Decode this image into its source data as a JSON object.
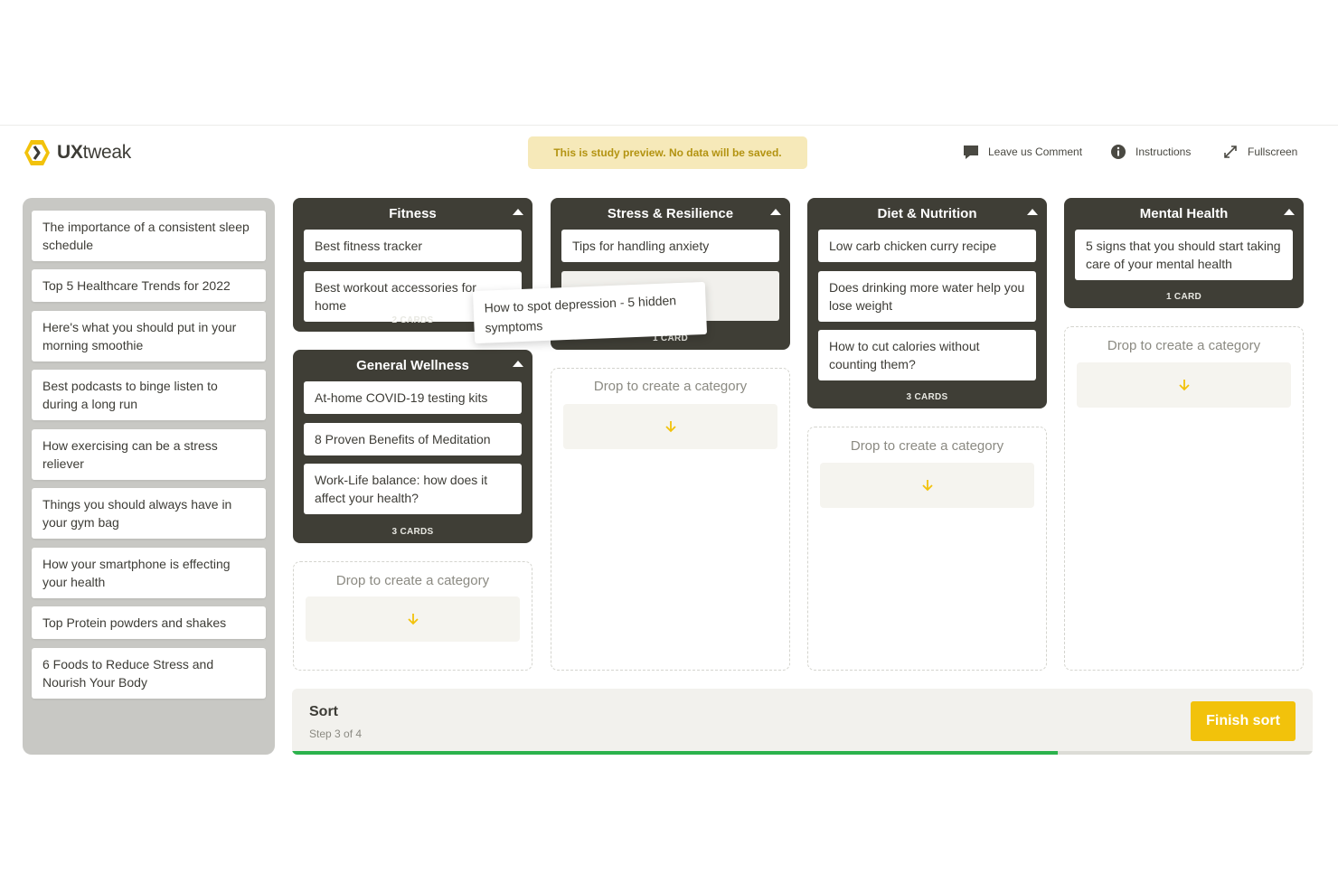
{
  "header": {
    "logo_prefix": "UX",
    "logo_suffix": "tweak",
    "banner": "This is study preview. No data will be saved.",
    "comment_label": "Leave us Comment",
    "instructions_label": "Instructions",
    "fullscreen_label": "Fullscreen",
    "icons": {
      "comment": "comment-icon",
      "info": "info-icon",
      "fullscreen": "fullscreen-icon"
    }
  },
  "unsorted_cards": [
    "The importance of a consistent sleep schedule",
    "Top 5 Healthcare Trends for 2022",
    "Here's what you should put in your morning smoothie",
    "Best podcasts to binge listen to during a long run",
    "How exercising can be a stress reliever",
    "Things you should always have in your gym bag",
    "How your smartphone is effecting your health",
    "Top Protein powders and shakes",
    "6 Foods to Reduce Stress and Nourish Your Body"
  ],
  "categories": [
    {
      "title": "Fitness",
      "cards": [
        "Best fitness tracker",
        "Best workout accessories for home"
      ],
      "count": "2 CARDS"
    },
    {
      "title": "General Wellness",
      "cards": [
        "At-home COVID-19 testing kits",
        "8 Proven Benefits of Meditation",
        "Work-Life balance: how does it affect your health?"
      ],
      "count": "3 CARDS"
    },
    {
      "title": "Stress & Resilience",
      "cards": [
        "Tips for handling anxiety"
      ],
      "count": "1 CARD"
    },
    {
      "title": "Diet & Nutrition",
      "cards": [
        "Low carb chicken curry recipe",
        "Does drinking more water help you lose weight",
        "How to cut calories without counting them?"
      ],
      "count": "3 CARDS"
    },
    {
      "title": "Mental Health",
      "cards": [
        "5 signs that you should start taking care of your mental health"
      ],
      "count": "1 CARD"
    }
  ],
  "dragging_card": "How to spot depression - 5 hidden symptoms",
  "drop_label": "Drop to create a category",
  "footer": {
    "title": "Sort",
    "step": "Step 3 of 4",
    "finish_label": "Finish sort",
    "progress": 0.75
  },
  "colors": {
    "accent": "#f2c20b",
    "category_bg": "#3f3e36",
    "progress": "#2bb24c",
    "banner_bg": "#f6e9b9"
  }
}
